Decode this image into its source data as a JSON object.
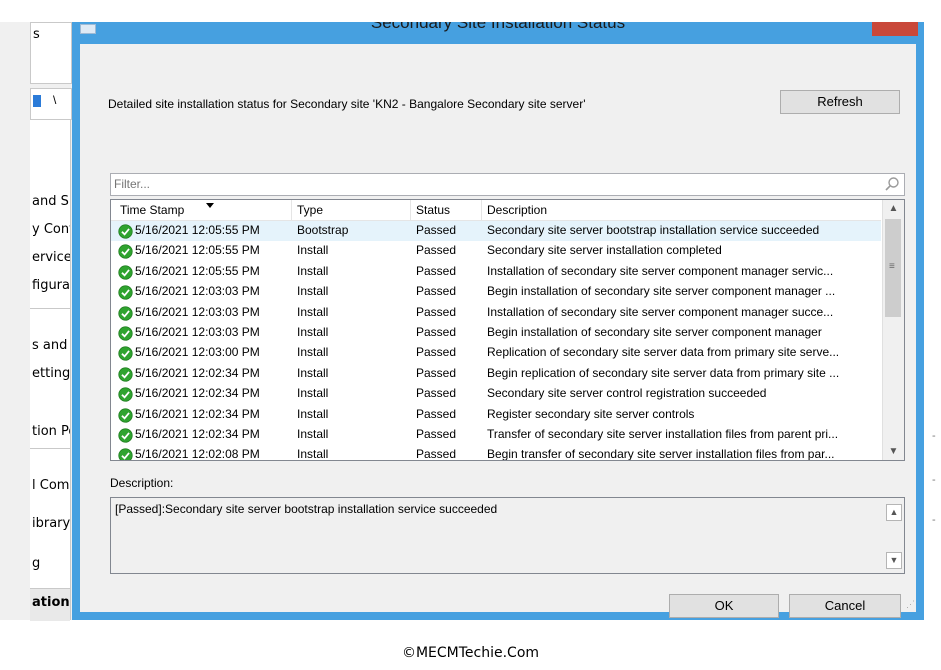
{
  "background": {
    "labels": [
      "s",
      "and S",
      "y Cont",
      "ervices",
      "figurat",
      "s and S",
      "ettings",
      "tion Po",
      "l Comp",
      "ibrary",
      "g",
      "ation"
    ],
    "tab_char": "\\",
    "right_ticks": [
      "-",
      "-",
      "-"
    ]
  },
  "dialog": {
    "title": "Secondary Site Installation Status",
    "headline": "Detailed site installation status for Secondary site 'KN2 - Bangalore Secondary site server'",
    "refresh_label": "Refresh",
    "filter_placeholder": "Filter...",
    "columns": {
      "timestamp": "Time Stamp",
      "type": "Type",
      "status": "Status",
      "description": "Description"
    },
    "rows": [
      {
        "timestamp": "5/16/2021 12:05:55 PM",
        "type": "Bootstrap",
        "status": "Passed",
        "description": "Secondary site server bootstrap installation service succeeded"
      },
      {
        "timestamp": "5/16/2021 12:05:55 PM",
        "type": "Install",
        "status": "Passed",
        "description": "Secondary site server installation completed"
      },
      {
        "timestamp": "5/16/2021 12:05:55 PM",
        "type": "Install",
        "status": "Passed",
        "description": "Installation of secondary site server component manager servic..."
      },
      {
        "timestamp": "5/16/2021 12:03:03 PM",
        "type": "Install",
        "status": "Passed",
        "description": "Begin installation of secondary site server component manager ..."
      },
      {
        "timestamp": "5/16/2021 12:03:03 PM",
        "type": "Install",
        "status": "Passed",
        "description": "Installation of secondary site server component manager succe..."
      },
      {
        "timestamp": "5/16/2021 12:03:03 PM",
        "type": "Install",
        "status": "Passed",
        "description": "Begin installation of secondary site server component manager"
      },
      {
        "timestamp": "5/16/2021 12:03:00 PM",
        "type": "Install",
        "status": "Passed",
        "description": "Replication of secondary site server data from primary site serve..."
      },
      {
        "timestamp": "5/16/2021 12:02:34 PM",
        "type": "Install",
        "status": "Passed",
        "description": "Begin replication of secondary site server data from primary site ..."
      },
      {
        "timestamp": "5/16/2021 12:02:34 PM",
        "type": "Install",
        "status": "Passed",
        "description": "Secondary site server control registration succeeded"
      },
      {
        "timestamp": "5/16/2021 12:02:34 PM",
        "type": "Install",
        "status": "Passed",
        "description": "Register secondary site server controls"
      },
      {
        "timestamp": "5/16/2021 12:02:34 PM",
        "type": "Install",
        "status": "Passed",
        "description": "Transfer of secondary site server installation files from parent pri..."
      },
      {
        "timestamp": "5/16/2021 12:02:08 PM",
        "type": "Install",
        "status": "Passed",
        "description": "Begin transfer of secondary site server installation files from par..."
      }
    ],
    "description_label": "Description:",
    "description_text": "[Passed]:Secondary site server bootstrap installation service succeeded",
    "ok_label": "OK",
    "cancel_label": "Cancel"
  },
  "watermark": "©MECMTechie.Com",
  "colors": {
    "title_bar": "#46a0e0",
    "close_button": "#c9483a",
    "passed_icon": "#2fa32f",
    "selected_row": "#e5f3fb"
  }
}
